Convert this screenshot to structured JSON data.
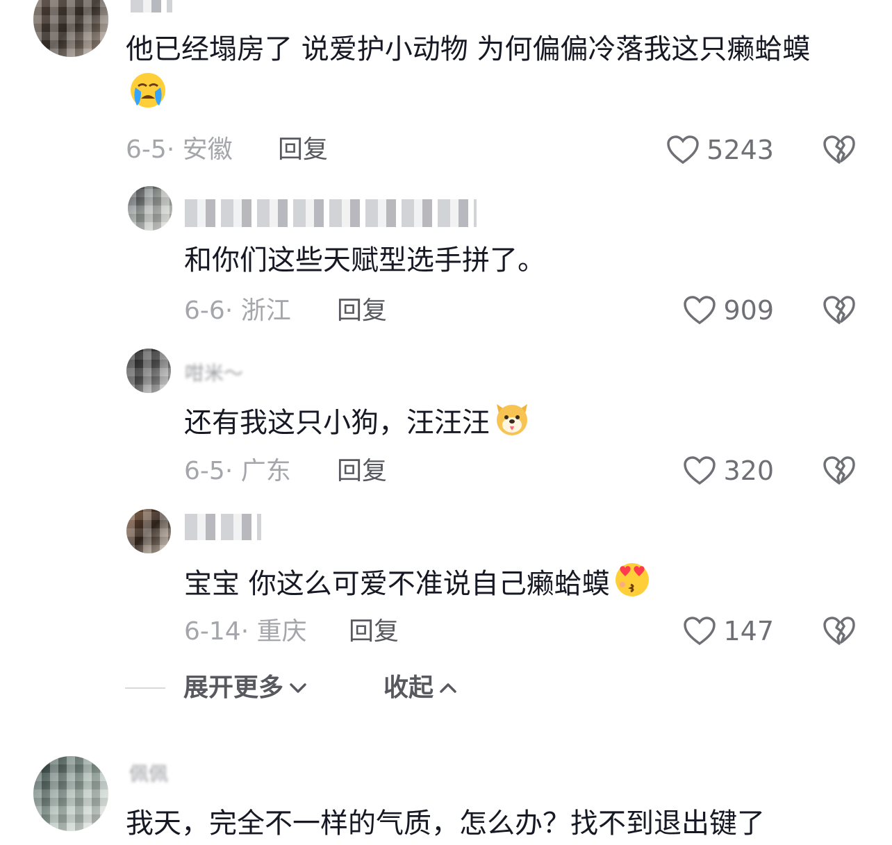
{
  "comments": [
    {
      "text": "他已经塌房了  说爱护小动物  为何偏偏冷落我这只癞蛤蟆",
      "emoji": "loudly-crying-face",
      "date": "6-5",
      "location": "安徽",
      "reply": "回复",
      "likes": "5243"
    },
    {
      "text": "和你们这些天赋型选手拼了。",
      "date": "6-6",
      "location": "浙江",
      "reply": "回复",
      "likes": "909"
    },
    {
      "username": "咁米～",
      "text": "还有我这只小狗，汪汪汪",
      "emoji": "dog-face",
      "date": "6-5",
      "location": "广东",
      "reply": "回复",
      "likes": "320"
    },
    {
      "text": "宝宝 你这么可爱不准说自己癞蛤蟆",
      "emoji": "heart-eyes-kiss-face",
      "date": "6-14",
      "location": "重庆",
      "reply": "回复",
      "likes": "147"
    },
    {
      "username": "佩佩",
      "text": "我天，完全不一样的气质，怎么办？找不到退出键了"
    }
  ],
  "thread_controls": {
    "expand_label": "展开更多",
    "collapse_label": "收起"
  },
  "colors": {
    "text": "#161823",
    "meta": "#a4a6ab",
    "action": "#57595f"
  }
}
